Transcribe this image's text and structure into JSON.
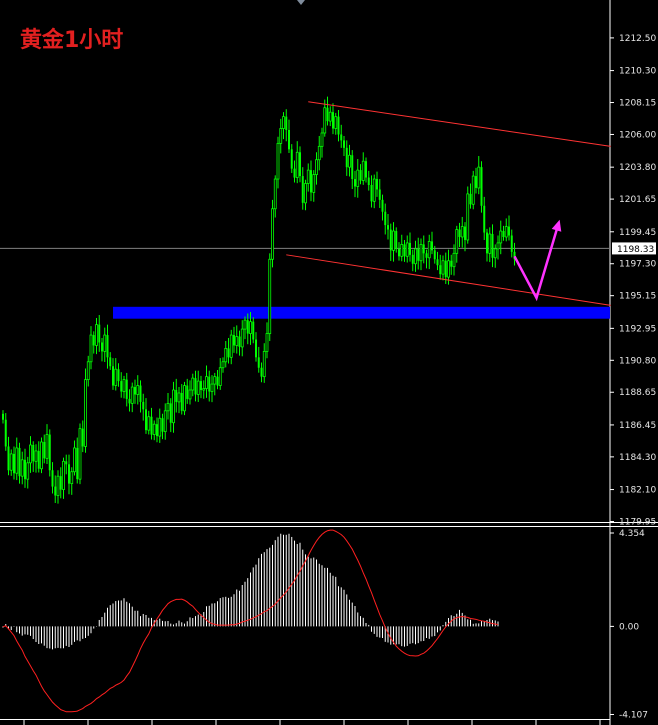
{
  "title": "黄金1小时",
  "colors": {
    "background": "#000000",
    "up_candle": "#00ff00",
    "down_candle": "#00ff00",
    "channel_lines": "#ff3333",
    "support_zone": "#0000ff",
    "projection_arrow": "#ff33ff",
    "current_price_line": "#808080",
    "macd_histogram": "#ffffff",
    "signal_line": "#ff2020",
    "axis": "#ffffff"
  },
  "price_axis": {
    "ticks": [
      "1212.50",
      "1210.30",
      "1208.15",
      "1206.00",
      "1203.80",
      "1201.65",
      "1199.45",
      "1197.30",
      "1195.15",
      "1192.95",
      "1190.80",
      "1188.65",
      "1186.45",
      "1184.30",
      "1182.10",
      "1179.95"
    ],
    "current_price": "1198.33"
  },
  "macd_axis": {
    "ticks": [
      "4.354",
      "0.00",
      "-4.107"
    ]
  },
  "chart_data": [
    {
      "type": "candlestick",
      "title": "黄金1小时",
      "ylim": [
        1179.95,
        1213.2
      ],
      "current_price": 1198.33,
      "support_zone": [
        1193.6,
        1194.4
      ],
      "channel": {
        "upper": [
          {
            "bar": 111,
            "price": 1208.2
          },
          {
            "bar": 221,
            "price": 1205.2
          }
        ],
        "lower": [
          {
            "bar": 103,
            "price": 1197.9
          },
          {
            "bar": 221,
            "price": 1194.5
          }
        ]
      },
      "projection": [
        {
          "bar": 186,
          "price": 1197.8
        },
        {
          "bar": 194,
          "price": 1195.0
        },
        {
          "bar": 202,
          "price": 1200.0
        }
      ],
      "bar_count": 185,
      "closes": [
        1186.8,
        1185.0,
        1183.4,
        1184.5,
        1183.2,
        1184.9,
        1183.0,
        1184.1,
        1182.8,
        1183.9,
        1185.1,
        1184.0,
        1184.7,
        1183.5,
        1185.3,
        1184.2,
        1185.8,
        1183.4,
        1182.3,
        1181.7,
        1183.0,
        1182.1,
        1184.0,
        1183.8,
        1182.5,
        1183.3,
        1184.9,
        1182.8,
        1186.2,
        1185.0,
        1189.5,
        1190.7,
        1192.5,
        1191.8,
        1193.2,
        1192.0,
        1191.4,
        1192.5,
        1191.0,
        1190.4,
        1189.1,
        1190.2,
        1189.4,
        1188.7,
        1189.5,
        1188.2,
        1187.9,
        1189.0,
        1188.5,
        1189.1,
        1188.0,
        1187.5,
        1186.1,
        1187.0,
        1185.8,
        1186.5,
        1185.7,
        1186.9,
        1186.0,
        1187.4,
        1187.9,
        1186.6,
        1188.8,
        1188.0,
        1188.6,
        1187.4,
        1189.1,
        1188.2,
        1188.8,
        1189.6,
        1188.5,
        1189.4,
        1188.8,
        1188.9,
        1189.7,
        1188.7,
        1189.2,
        1189.7,
        1189.1,
        1190.3,
        1190.7,
        1191.6,
        1191.0,
        1192.5,
        1191.8,
        1192.4,
        1191.7,
        1192.9,
        1193.5,
        1192.6,
        1193.4,
        1192.2,
        1191.0,
        1190.3,
        1189.7,
        1191.4,
        1192.6,
        1197.6,
        1201.0,
        1203.0,
        1205.4,
        1206.4,
        1207.2,
        1206.3,
        1205.0,
        1203.7,
        1203.1,
        1204.8,
        1203.2,
        1201.4,
        1202.7,
        1203.6,
        1202.1,
        1203.3,
        1204.3,
        1205.2,
        1206.1,
        1207.8,
        1206.9,
        1207.5,
        1206.4,
        1207.2,
        1206.0,
        1205.6,
        1205.1,
        1203.8,
        1204.6,
        1203.0,
        1202.5,
        1203.6,
        1202.9,
        1204.2,
        1203.1,
        1202.6,
        1201.5,
        1203.0,
        1202.3,
        1201.6,
        1200.8,
        1199.9,
        1199.6,
        1198.2,
        1199.5,
        1198.3,
        1197.8,
        1198.6,
        1197.8,
        1198.7,
        1197.9,
        1197.3,
        1198.3,
        1197.5,
        1198.6,
        1198.0,
        1197.7,
        1198.8,
        1198.2,
        1197.6,
        1197.2,
        1196.6,
        1197.5,
        1196.4,
        1197.5,
        1197.1,
        1198.0,
        1199.6,
        1199.1,
        1199.8,
        1198.9,
        1202.0,
        1201.3,
        1203.2,
        1202.4,
        1203.8,
        1201.2,
        1199.4,
        1198.0,
        1199.3,
        1197.7,
        1198.3,
        1198.7,
        1199.5,
        1199.1,
        1199.8,
        1199.2,
        1198.1,
        1197.6
      ]
    },
    {
      "type": "bar",
      "title": "",
      "ylim": [
        -4.107,
        4.354
      ],
      "histogram": [
        -0.06,
        0.11,
        -0.12,
        -0.17,
        -0.02,
        -0.27,
        -0.33,
        -0.43,
        -0.37,
        -0.39,
        -0.44,
        -0.59,
        -0.73,
        -0.82,
        -0.79,
        -0.9,
        -1.01,
        -1.03,
        -1.07,
        -1.02,
        -1.0,
        -1.02,
        -1.02,
        -0.91,
        -0.96,
        -0.86,
        -0.72,
        -0.65,
        -0.69,
        -0.58,
        -0.54,
        -0.44,
        -0.32,
        -0.1,
        0.02,
        0.3,
        0.44,
        0.64,
        0.87,
        0.99,
        1.07,
        1.18,
        1.21,
        1.21,
        1.31,
        1.15,
        1.08,
        0.92,
        0.73,
        0.73,
        0.48,
        0.58,
        0.53,
        0.4,
        0.4,
        0.29,
        0.29,
        0.36,
        0.26,
        0.24,
        0.25,
        0.13,
        0.09,
        0.15,
        0.27,
        0.19,
        0.13,
        0.24,
        0.42,
        0.39,
        0.48,
        0.55,
        0.56,
        0.67,
        0.94,
        0.96,
        1.07,
        1.08,
        1.17,
        1.32,
        1.36,
        1.38,
        1.33,
        1.38,
        1.5,
        1.72,
        1.66,
        1.93,
        2.08,
        2.25,
        2.51,
        2.75,
        2.88,
        3.18,
        3.38,
        3.46,
        3.6,
        3.67,
        3.8,
        4.02,
        4.18,
        4.32,
        4.27,
        4.27,
        4.32,
        4.17,
        4.0,
        3.84,
        3.9,
        3.58,
        3.36,
        3.25,
        3.17,
        3.21,
        3.12,
        2.92,
        2.85,
        2.73,
        2.73,
        2.5,
        2.36,
        2.31,
        1.87,
        1.82,
        1.71,
        1.49,
        1.24,
        1.11,
        0.95,
        0.65,
        0.48,
        0.4,
        0.16,
        0.07,
        -0.25,
        -0.35,
        -0.49,
        -0.52,
        -0.54,
        -0.72,
        -0.75,
        -0.85,
        -0.83,
        -0.84,
        -0.83,
        -0.92,
        -0.94,
        -0.91,
        -0.81,
        -0.78,
        -0.83,
        -0.78,
        -0.69,
        -0.68,
        -0.54,
        -0.58,
        -0.47,
        -0.45,
        -0.28,
        -0.19,
        0.06,
        0.21,
        0.39,
        0.52,
        0.48,
        0.59,
        0.77,
        0.63,
        0.51,
        0.33,
        0.31,
        0.12,
        0.14,
        0.14,
        0.25,
        0.24,
        0.3,
        0.36,
        0.29,
        0.28,
        0.23
      ],
      "signal": [
        -0.02,
        0.03,
        -0.11,
        -0.27,
        -0.43,
        -0.68,
        -0.9,
        -1.11,
        -1.4,
        -1.62,
        -1.84,
        -2.07,
        -2.27,
        -2.53,
        -2.79,
        -3.01,
        -3.18,
        -3.36,
        -3.53,
        -3.66,
        -3.77,
        -3.88,
        -3.93,
        -3.98,
        -3.98,
        -3.98,
        -3.97,
        -3.95,
        -3.89,
        -3.83,
        -3.73,
        -3.66,
        -3.59,
        -3.49,
        -3.37,
        -3.29,
        -3.19,
        -3.11,
        -3.0,
        -2.89,
        -2.83,
        -2.74,
        -2.68,
        -2.61,
        -2.5,
        -2.31,
        -2.14,
        -1.88,
        -1.62,
        -1.34,
        -1.04,
        -0.78,
        -0.55,
        -0.35,
        -0.06,
        0.15,
        0.35,
        0.54,
        0.75,
        0.9,
        1.06,
        1.15,
        1.21,
        1.26,
        1.26,
        1.27,
        1.22,
        1.14,
        1.03,
        0.94,
        0.79,
        0.65,
        0.52,
        0.42,
        0.29,
        0.19,
        0.13,
        0.1,
        0.06,
        0.06,
        0.06,
        0.06,
        0.06,
        0.08,
        0.07,
        0.11,
        0.14,
        0.21,
        0.24,
        0.29,
        0.33,
        0.4,
        0.45,
        0.52,
        0.59,
        0.69,
        0.73,
        0.84,
        0.93,
        1.04,
        1.19,
        1.33,
        1.46,
        1.61,
        1.79,
        1.96,
        2.14,
        2.37,
        2.57,
        2.82,
        3.05,
        3.3,
        3.55,
        3.77,
        3.98,
        4.15,
        4.29,
        4.39,
        4.46,
        4.49,
        4.49,
        4.43,
        4.36,
        4.28,
        4.16,
        3.99,
        3.8,
        3.6,
        3.34,
        3.09,
        2.81,
        2.5,
        2.21,
        1.88,
        1.57,
        1.22,
        0.89,
        0.55,
        0.26,
        -0.05,
        -0.31,
        -0.55,
        -0.74,
        -0.92,
        -1.05,
        -1.16,
        -1.25,
        -1.32,
        -1.36,
        -1.37,
        -1.38,
        -1.37,
        -1.3,
        -1.25,
        -1.15,
        -1.03,
        -0.9,
        -0.73,
        -0.57,
        -0.38,
        -0.19,
        -0.02,
        0.12,
        0.25,
        0.35,
        0.41,
        0.44,
        0.46,
        0.44,
        0.42,
        0.37,
        0.35,
        0.33,
        0.29,
        0.26,
        0.24,
        0.2,
        0.17,
        0.13,
        0.11,
        0.08
      ]
    }
  ]
}
